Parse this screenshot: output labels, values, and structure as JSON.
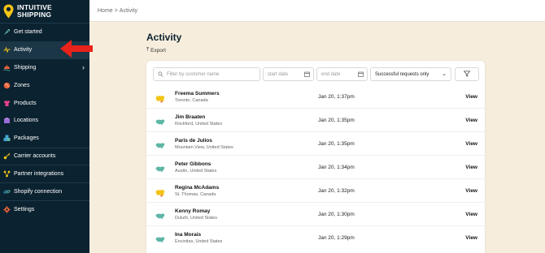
{
  "brand": {
    "line1": "INTUITIVE",
    "line2": "SHIPPING",
    "pin_color": "#f2c416"
  },
  "sidebar": {
    "items": [
      {
        "label": "Get started",
        "icon": "rocket-icon"
      },
      {
        "label": "Activity",
        "icon": "activity-icon",
        "active": true
      },
      {
        "label": "Shipping",
        "icon": "shipping-icon",
        "has_chevron": true
      },
      {
        "label": "Zones",
        "icon": "zones-icon"
      },
      {
        "label": "Products",
        "icon": "products-icon"
      },
      {
        "label": "Locations",
        "icon": "locations-icon"
      },
      {
        "label": "Packages",
        "icon": "packages-icon"
      },
      {
        "label": "Carrier accounts",
        "icon": "key-icon"
      },
      {
        "label": "Partner integrations",
        "icon": "integrations-icon"
      },
      {
        "label": "Shopify connection",
        "icon": "link-icon"
      },
      {
        "label": "Settings",
        "icon": "gear-icon"
      }
    ],
    "chevron": "›"
  },
  "breadcrumb": {
    "home": "Home",
    "separator": ">",
    "current": "Activity"
  },
  "page": {
    "title": "Activity",
    "export_label": "Export"
  },
  "filters": {
    "search_placeholder": "Filter by customer name",
    "start_date_placeholder": "start date",
    "end_date_placeholder": "end date",
    "status_selected": "Successful requests only"
  },
  "activity": {
    "view_label": "View",
    "rows": [
      {
        "name": "Freema Summers",
        "location": "Toronto, Canada",
        "date": "Jan 20, 1:37pm",
        "country_flag": "canada-flag-icon"
      },
      {
        "name": "Jim Braaten",
        "location": "Rockford, United States",
        "date": "Jan 20, 1:35pm",
        "country_flag": "usa-flag-icon"
      },
      {
        "name": "Paris de Julios",
        "location": "Mountain View, United States",
        "date": "Jan 20, 1:35pm",
        "country_flag": "usa-flag-icon"
      },
      {
        "name": "Peter Gibbons",
        "location": "Austin, United States",
        "date": "Jan 20, 1:34pm",
        "country_flag": "usa-flag-icon"
      },
      {
        "name": "Regina McAdams",
        "location": "St. Thomas, Canada",
        "date": "Jan 20, 1:32pm",
        "country_flag": "canada-flag-icon"
      },
      {
        "name": "Kenny Romay",
        "location": "Duluth, United States",
        "date": "Jan 20, 1:30pm",
        "country_flag": "usa-flag-icon"
      },
      {
        "name": "Ina Morais",
        "location": "Encinitas, United States",
        "date": "Jan 20, 1:29pm",
        "country_flag": "usa-flag-icon"
      }
    ]
  },
  "colors": {
    "sidebar": "#0b2230",
    "background": "#f6eddc",
    "annotation_arrow": "#e8231b",
    "usa_map": "#5fb6a6",
    "canada_map": "#f2c416"
  }
}
